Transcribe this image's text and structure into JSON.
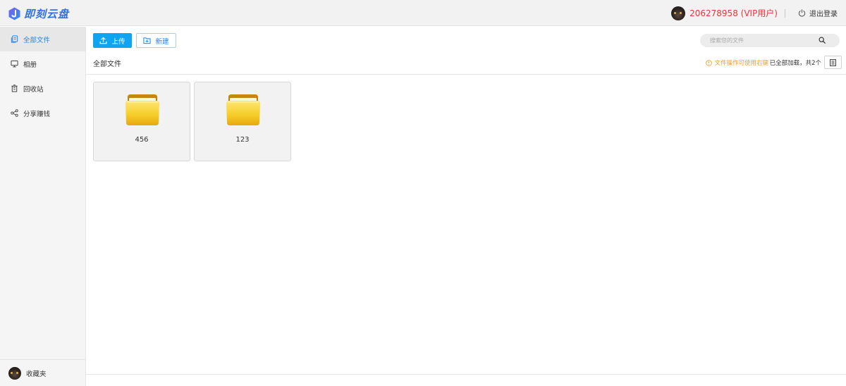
{
  "header": {
    "logo_text": "即刻云盘",
    "user_name": "206278958 (VIP用户)",
    "logout_label": "退出登录"
  },
  "sidebar": {
    "items": [
      {
        "label": "全部文件",
        "icon": "files-icon",
        "active": true
      },
      {
        "label": "相册",
        "icon": "monitor-icon",
        "active": false
      },
      {
        "label": "回收站",
        "icon": "trash-icon",
        "active": false
      },
      {
        "label": "分享赚钱",
        "icon": "share-icon",
        "active": false
      }
    ],
    "footer_label": "收藏夹"
  },
  "toolbar": {
    "upload_label": "上传",
    "new_label": "新建"
  },
  "search": {
    "placeholder": "搜索您的文件"
  },
  "breadcrumb": {
    "title": "全部文件",
    "tip": "文件操作可使用右键",
    "count": "已全部加载，共2个"
  },
  "files": [
    {
      "name": "456",
      "type": "folder"
    },
    {
      "name": "123",
      "type": "folder"
    }
  ],
  "colors": {
    "accent": "#0ea4ef",
    "active_nav": "#1d86f0",
    "vip_user": "#e8363a",
    "tip": "#f29a2e"
  }
}
